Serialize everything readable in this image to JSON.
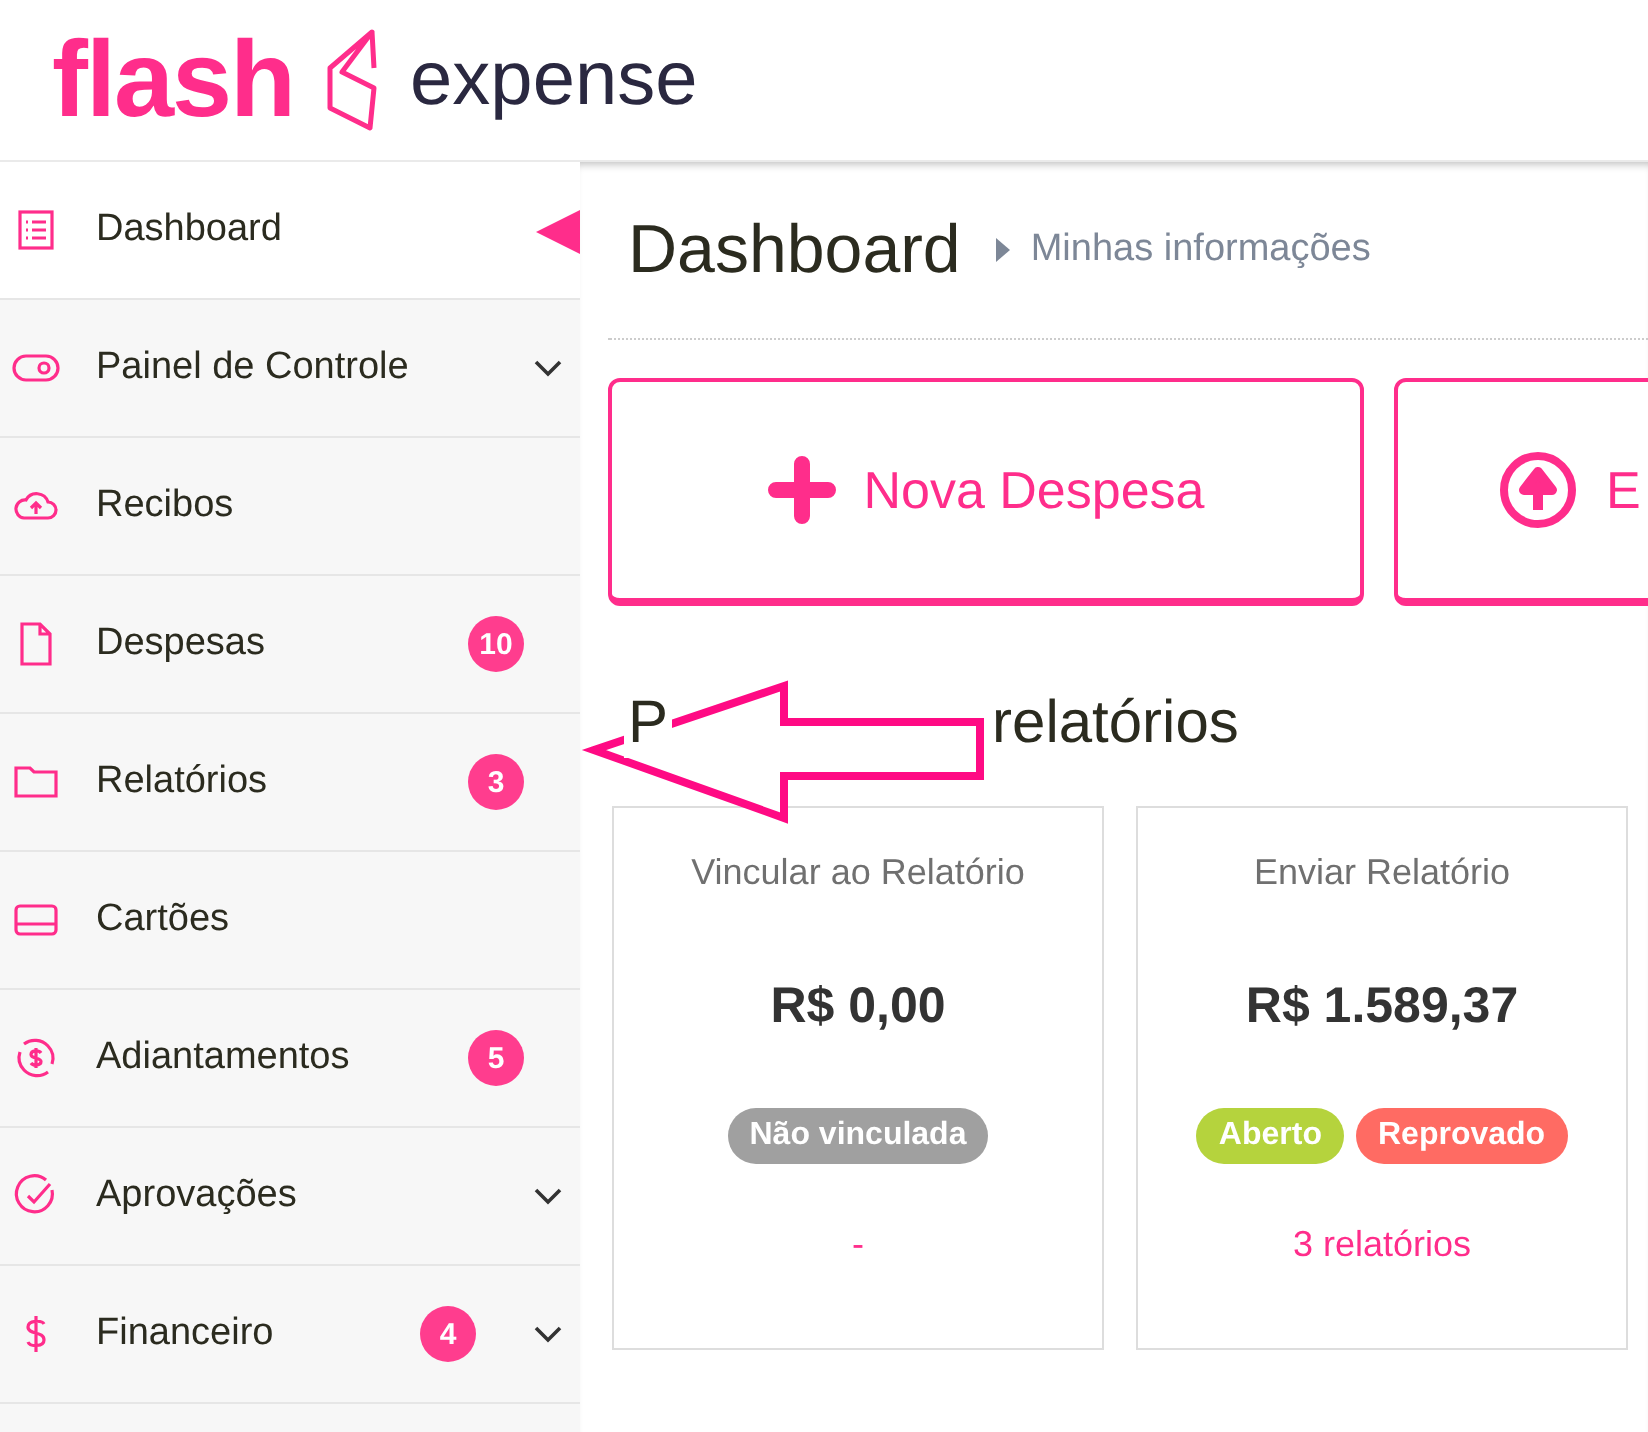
{
  "logo": {
    "brand": "flash",
    "product": "expense"
  },
  "sidebar": {
    "items": [
      {
        "label": "Dashboard",
        "kind": "link",
        "selected": true
      },
      {
        "label": "Painel de Controle",
        "kind": "group",
        "expanded": false,
        "selected": false
      },
      {
        "label": "Recibos",
        "kind": "link",
        "selected": false
      },
      {
        "label": "Despesas",
        "kind": "link",
        "badge": "10",
        "selected": false
      },
      {
        "label": "Relatórios",
        "kind": "link",
        "badge": "3",
        "selected": false
      },
      {
        "label": "Cartões",
        "kind": "link",
        "selected": false
      },
      {
        "label": "Adiantamentos",
        "kind": "link",
        "badge": "5",
        "selected": false
      },
      {
        "label": "Aprovações",
        "kind": "group",
        "expanded": false,
        "selected": false
      },
      {
        "label": "Financeiro",
        "kind": "group",
        "badge": "4",
        "expanded": false,
        "selected": false
      }
    ]
  },
  "page": {
    "title": "Dashboard",
    "breadcrumb": "Minhas informações"
  },
  "actions": [
    {
      "label": "Nova Despesa",
      "kind": "add"
    },
    {
      "label": "E",
      "kind": "upload"
    }
  ],
  "section": {
    "title_start": "P",
    "title_end": "relatórios"
  },
  "cards": [
    {
      "title": "Vincular ao Relatório",
      "amount": "R$ 0,00",
      "tags": [
        {
          "label": "Não vinculada",
          "color": "#a0a0a0"
        }
      ],
      "footer": "-"
    },
    {
      "title": "Enviar Relatório",
      "amount": "R$ 1.589,37",
      "tags": [
        {
          "label": "Aberto",
          "color": "#b5d33d"
        },
        {
          "label": "Reprovado",
          "color": "#ff6b63"
        }
      ],
      "footer": "3 relatórios"
    }
  ]
}
